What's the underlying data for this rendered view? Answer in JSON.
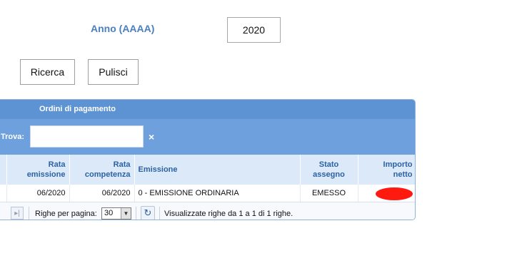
{
  "form": {
    "year_label": "Anno (AAAA)",
    "year_value": "2020",
    "search_label": "Ricerca",
    "clear_label": "Pulisci"
  },
  "grid": {
    "title": "Ordini di pagamento",
    "find_label": "Trova:",
    "find_value": "",
    "find_clear_icon": "×",
    "columns": [
      {
        "line1": "Rata",
        "line2": "emissione"
      },
      {
        "line1": "Rata",
        "line2": "competenza"
      },
      {
        "line1": "Emissione",
        "line2": ""
      },
      {
        "line1": "Stato",
        "line2": "assegno"
      },
      {
        "line1": "Importo",
        "line2": "netto"
      }
    ],
    "rows": [
      {
        "rata_emissione": "06/2020",
        "rata_competenza": "06/2020",
        "emissione": "0 - EMISSIONE ORDINARIA",
        "stato_assegno": "EMESSO",
        "importo_netto": "redacted"
      }
    ]
  },
  "pager": {
    "rows_per_page_label": "Righe per pagina:",
    "rows_per_page_value": "30",
    "info": "Visualizzate righe da 1 a 1 di 1 righe."
  },
  "icons": {
    "last_page": "last-page-icon",
    "refresh": "refresh-icon",
    "dropdown": "chevron-down-icon",
    "clear": "clear-search-icon"
  },
  "colors": {
    "panel_header": "#5d93d2",
    "find_bar": "#6da0dd",
    "column_header": "#dce9f8",
    "label_blue": "#4a7fc0",
    "redaction": "#ff1a10"
  }
}
